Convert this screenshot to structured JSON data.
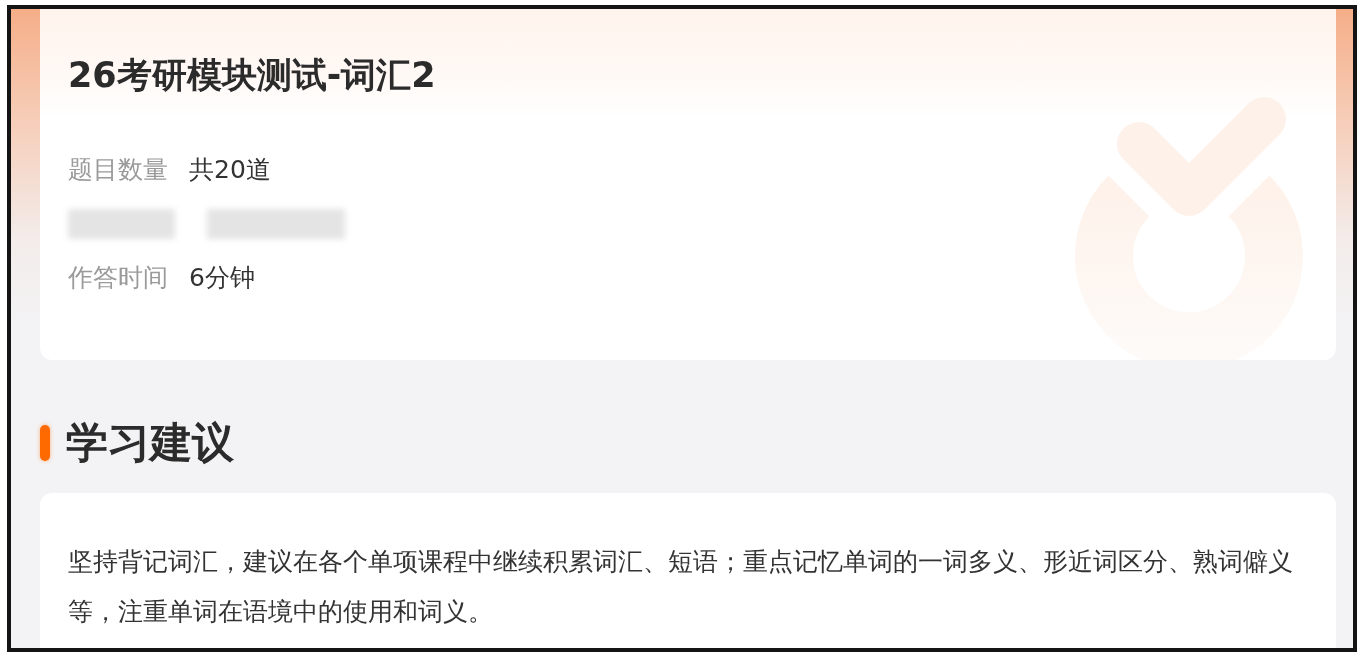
{
  "test": {
    "title": "26考研模块测试-词汇2",
    "info_rows": [
      {
        "kind": "text",
        "label": "题目数量",
        "value": "共20道"
      },
      {
        "kind": "blurred"
      },
      {
        "kind": "text",
        "label": "作答时间",
        "value": "6分钟"
      }
    ]
  },
  "advice": {
    "heading": "学习建议",
    "text": "坚持背记词汇，建议在各个单项课程中继续积累词汇、短语；重点记忆单词的一词多义、形近词区分、熟词僻义等，注重单词在语境中的使用和词义。"
  }
}
